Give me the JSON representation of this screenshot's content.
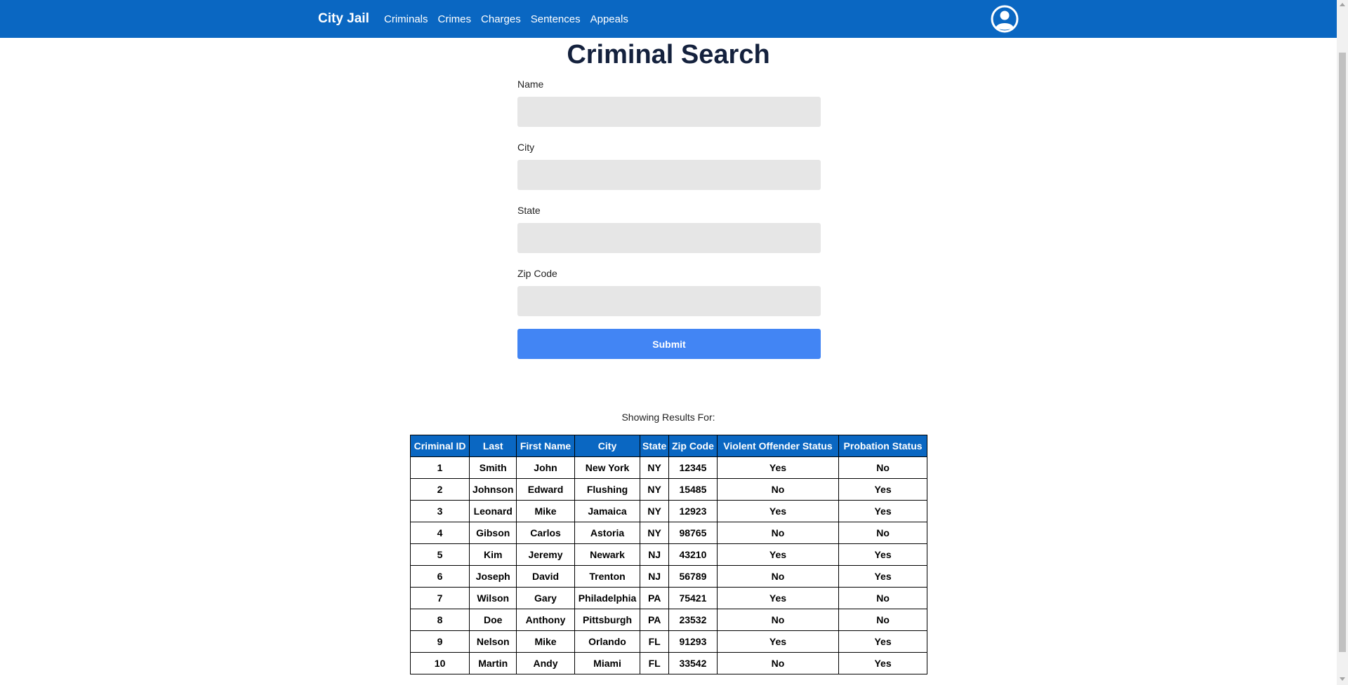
{
  "nav": {
    "brand": "City Jail",
    "links": [
      "Criminals",
      "Crimes",
      "Charges",
      "Sentences",
      "Appeals"
    ]
  },
  "page": {
    "title": "Criminal Search"
  },
  "form": {
    "fields": [
      {
        "label": "Name",
        "value": ""
      },
      {
        "label": "City",
        "value": ""
      },
      {
        "label": "State",
        "value": ""
      },
      {
        "label": "Zip Code",
        "value": ""
      }
    ],
    "submit_label": "Submit"
  },
  "results": {
    "caption": "Showing Results For:",
    "headers": [
      "Criminal ID",
      "Last",
      "First Name",
      "City",
      "State",
      "Zip Code",
      "Violent Offender Status",
      "Probation Status"
    ],
    "rows": [
      [
        "1",
        "Smith",
        "John",
        "New York",
        "NY",
        "12345",
        "Yes",
        "No"
      ],
      [
        "2",
        "Johnson",
        "Edward",
        "Flushing",
        "NY",
        "15485",
        "No",
        "Yes"
      ],
      [
        "3",
        "Leonard",
        "Mike",
        "Jamaica",
        "NY",
        "12923",
        "Yes",
        "Yes"
      ],
      [
        "4",
        "Gibson",
        "Carlos",
        "Astoria",
        "NY",
        "98765",
        "No",
        "No"
      ],
      [
        "5",
        "Kim",
        "Jeremy",
        "Newark",
        "NJ",
        "43210",
        "Yes",
        "Yes"
      ],
      [
        "6",
        "Joseph",
        "David",
        "Trenton",
        "NJ",
        "56789",
        "No",
        "Yes"
      ],
      [
        "7",
        "Wilson",
        "Gary",
        "Philadelphia",
        "PA",
        "75421",
        "Yes",
        "No"
      ],
      [
        "8",
        "Doe",
        "Anthony",
        "Pittsburgh",
        "PA",
        "23532",
        "No",
        "No"
      ],
      [
        "9",
        "Nelson",
        "Mike",
        "Orlando",
        "FL",
        "91293",
        "Yes",
        "Yes"
      ],
      [
        "10",
        "Martin",
        "Andy",
        "Miami",
        "FL",
        "33542",
        "No",
        "Yes"
      ]
    ]
  },
  "colors": {
    "navbar": "#0a67c2",
    "button": "#4285f4",
    "title": "#14213d",
    "input_bg": "#e6e6e6"
  },
  "icons": {
    "account": "user-circle-icon"
  }
}
